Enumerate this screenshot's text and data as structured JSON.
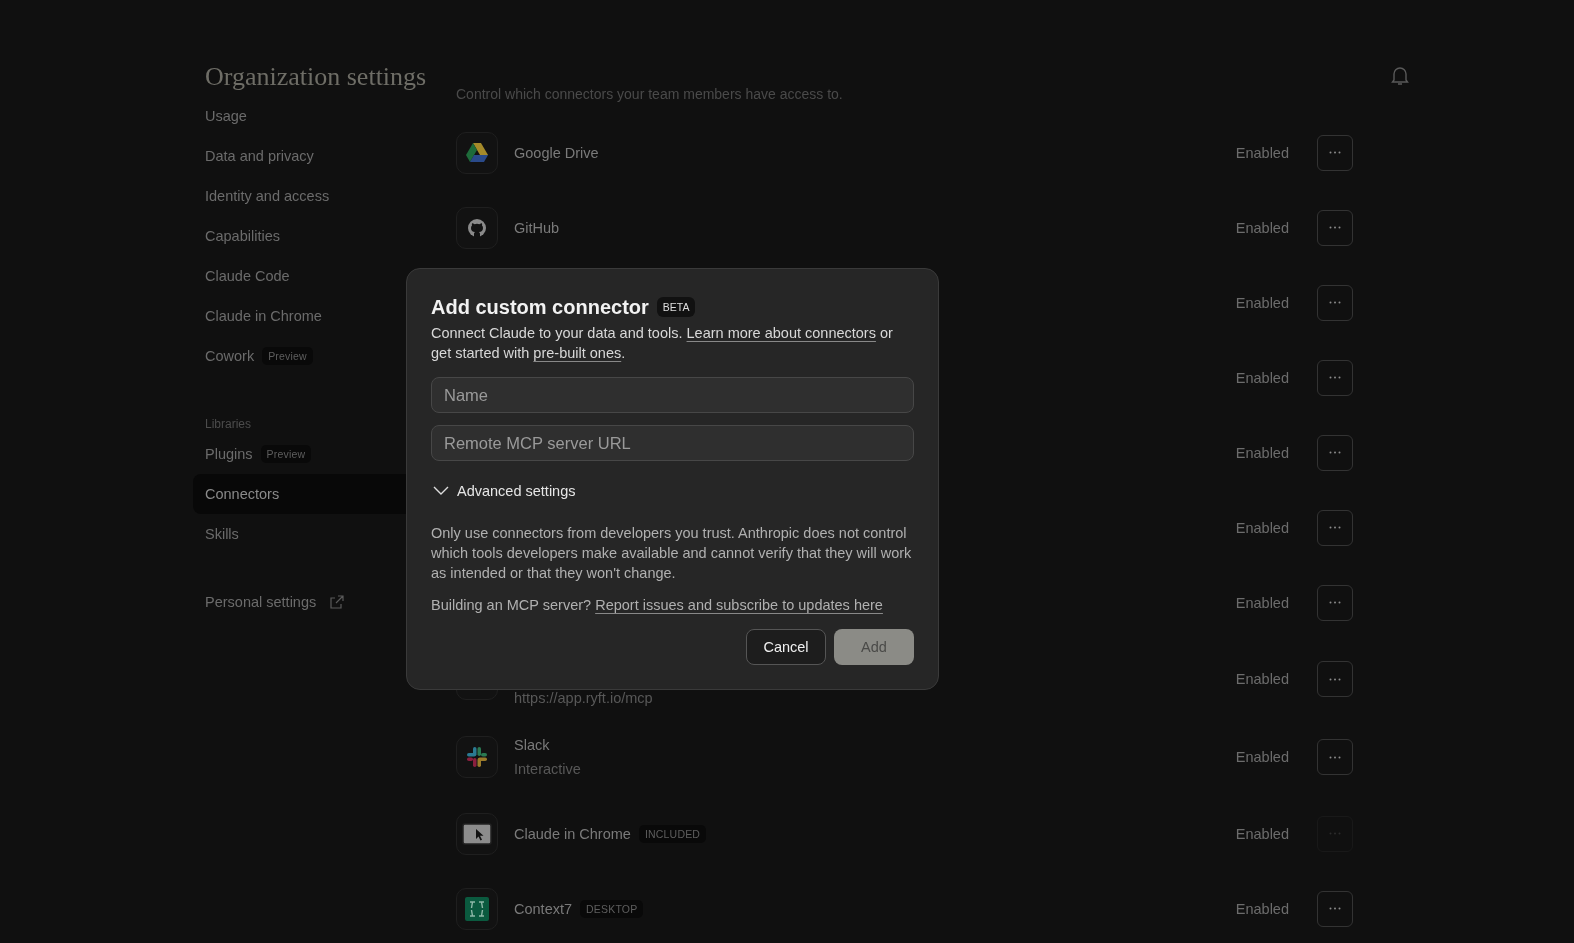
{
  "page": {
    "title": "Organization settings"
  },
  "sidebar": {
    "items": [
      {
        "label": "Usage",
        "selected": false
      },
      {
        "label": "Data and privacy",
        "selected": false
      },
      {
        "label": "Identity and access",
        "selected": false
      },
      {
        "label": "Capabilities",
        "selected": false
      },
      {
        "label": "Claude Code",
        "selected": false
      },
      {
        "label": "Claude in Chrome",
        "selected": false
      },
      {
        "label": "Cowork",
        "selected": false,
        "badge": "Preview"
      }
    ],
    "section_label": "Libraries",
    "library_items": [
      {
        "label": "Plugins",
        "selected": false,
        "badge": "Preview"
      },
      {
        "label": "Connectors",
        "selected": true
      },
      {
        "label": "Skills",
        "selected": false
      }
    ],
    "footer_link": {
      "label": "Personal settings"
    }
  },
  "connectors": {
    "description": "Control which connectors your team members have access to.",
    "rows": [
      {
        "kind": "google-drive",
        "name": "Google Drive",
        "status": "Enabled",
        "menu_disabled": false
      },
      {
        "kind": "github",
        "name": "GitHub",
        "status": "Enabled",
        "menu_disabled": false
      },
      {
        "status": "Enabled",
        "menu_disabled": false
      },
      {
        "status": "Enabled",
        "menu_disabled": false
      },
      {
        "status": "Enabled",
        "menu_disabled": false
      },
      {
        "status": "Enabled",
        "menu_disabled": false
      },
      {
        "status": "Enabled",
        "menu_disabled": false
      },
      {
        "subtitle": "https://app.ryft.io/mcp",
        "status": "Enabled",
        "menu_disabled": false
      },
      {
        "kind": "slack",
        "name": "Slack",
        "subtitle": "Interactive",
        "status": "Enabled",
        "menu_disabled": false
      },
      {
        "kind": "browser",
        "name": "Claude in Chrome",
        "badge": "INCLUDED",
        "status": "Enabled",
        "menu_disabled": true
      },
      {
        "kind": "context7",
        "name": "Context7",
        "badge": "DESKTOP",
        "status": "Enabled",
        "menu_disabled": false
      }
    ]
  },
  "dialog": {
    "title": "Add custom connector",
    "badge": "BETA",
    "intro": "Connect Claude to your data and tools. ",
    "intro_link": "Learn more about connectors",
    "intro_mid": " or get started with ",
    "intro_link2": "pre-built ones",
    "intro_end": ".",
    "fields": [
      {
        "placeholder": "Name"
      },
      {
        "placeholder": "Remote MCP server URL"
      }
    ],
    "advanced": {
      "label": "Advanced settings",
      "expanded": false
    },
    "warning": "Only use connectors from developers you trust. Anthropic does not control which tools developers make available and cannot verify that they will work as intended or that they won't change.",
    "building": "Building an MCP server? ",
    "building_link": "Report issues and subscribe to updates here",
    "buttons": [
      {
        "label": "Cancel",
        "kind": "secondary",
        "disabled": false
      },
      {
        "label": "Add",
        "kind": "primary",
        "disabled": true
      }
    ]
  }
}
